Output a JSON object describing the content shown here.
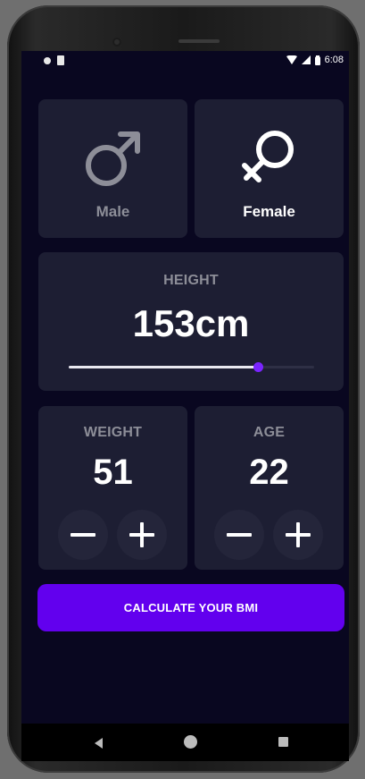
{
  "status_bar": {
    "time": "6:08"
  },
  "gender": {
    "male": {
      "label": "Male",
      "icon": "male-symbol-icon",
      "selected": false
    },
    "female": {
      "label": "Female",
      "icon": "female-symbol-icon",
      "selected": true
    }
  },
  "height": {
    "label": "HEIGHT",
    "value_text": "153cm",
    "slider_fraction": 0.77
  },
  "weight": {
    "label": "WEIGHT",
    "value": "51"
  },
  "age": {
    "label": "AGE",
    "value": "22"
  },
  "calculate_button": {
    "label": "CALCULATE YOUR BMI"
  },
  "colors": {
    "background": "#090720",
    "card": "#1d1e33",
    "inactive_text": "#8d8e98",
    "accent": "#6200ee",
    "thumb": "#7a24ff"
  },
  "nav_icons": [
    "back-icon",
    "home-icon",
    "recents-icon"
  ]
}
